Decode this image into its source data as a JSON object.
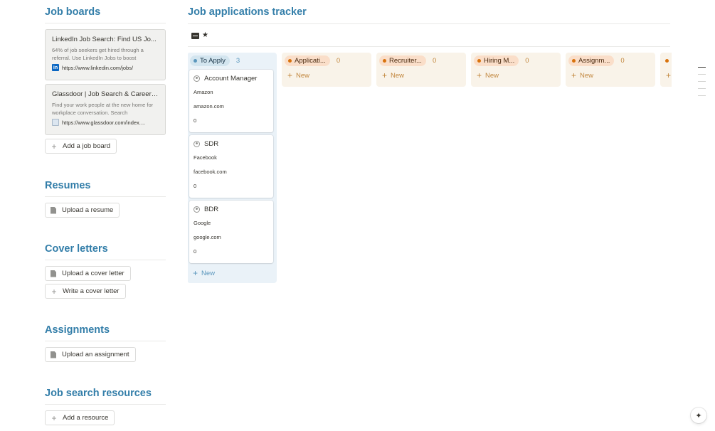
{
  "job_boards": {
    "title": "Job boards",
    "bookmarks": [
      {
        "title": "LinkedIn Job Search: Find US Jo...",
        "description": "64% of job seekers get hired through a referral. Use LinkedIn Jobs to boost",
        "url": "https://www.linkedin.com/jobs/",
        "icon": "linkedin-icon"
      },
      {
        "title": "Glassdoor | Job Search & Career ...",
        "description": "Find your work people at the new home for workplace conversation. Search",
        "url": "https://www.glassdoor.com/index....",
        "icon": "glassdoor-icon"
      }
    ],
    "add_label": "Add a job board"
  },
  "resumes": {
    "title": "Resumes",
    "upload_label": "Upload a resume"
  },
  "cover_letters": {
    "title": "Cover letters",
    "upload_label": "Upload a cover letter",
    "write_label": "Write a cover letter"
  },
  "assignments": {
    "title": "Assignments",
    "upload_label": "Upload an assignment"
  },
  "resources": {
    "title": "Job search resources",
    "add_label": "Add a resource"
  },
  "tracker": {
    "title": "Job applications tracker",
    "new_label": "New",
    "columns": [
      {
        "label": "To Apply",
        "count": "3",
        "color": "#5b97bd",
        "cards": [
          {
            "title": "Account Manager",
            "company": "Amazon",
            "website": "amazon.com",
            "number": "0"
          },
          {
            "title": "SDR",
            "company": "Facebook",
            "website": "facebook.com",
            "number": "0"
          },
          {
            "title": "BDR",
            "company": "Google",
            "website": "google.com",
            "number": "0"
          }
        ]
      },
      {
        "label": "Applicati...",
        "count": "0",
        "color": "#d9730d"
      },
      {
        "label": "Recruiter...",
        "count": "0",
        "color": "#d9730d"
      },
      {
        "label": "Hiring M...",
        "count": "0",
        "color": "#d9730d"
      },
      {
        "label": "Assignm...",
        "count": "0",
        "color": "#d9730d"
      }
    ]
  }
}
